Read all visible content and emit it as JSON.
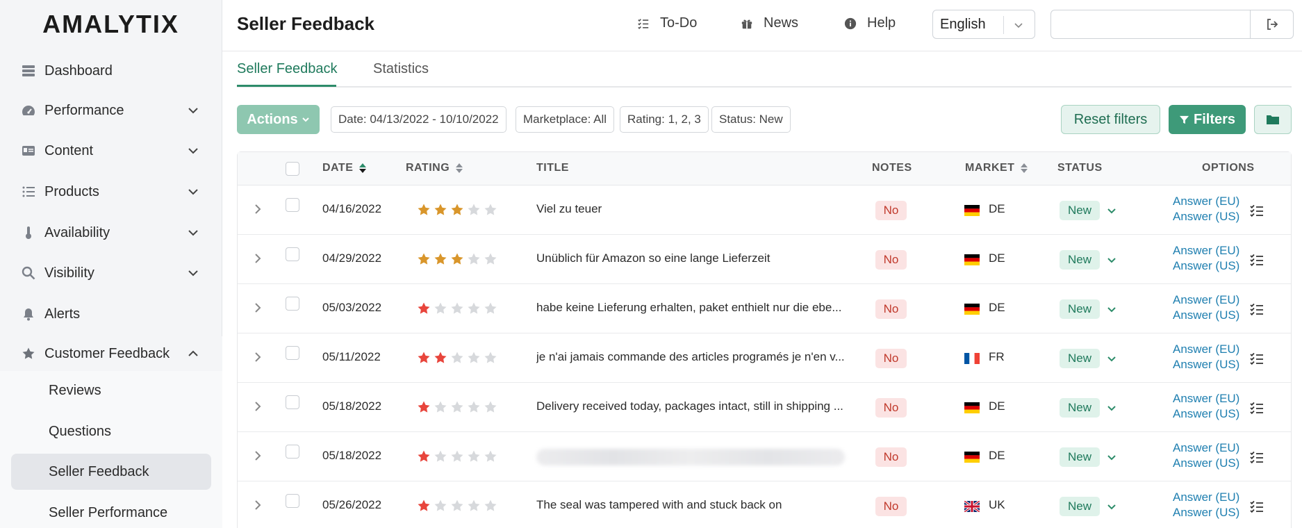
{
  "app": {
    "logo": "AMALYTIX"
  },
  "sidebar": {
    "items": [
      {
        "label": "Dashboard",
        "icon": "dashboard-icon",
        "has_chevron": false
      },
      {
        "label": "Performance",
        "icon": "gauge-icon",
        "has_chevron": true
      },
      {
        "label": "Content",
        "icon": "id-card-icon",
        "has_chevron": true
      },
      {
        "label": "Products",
        "icon": "list-icon",
        "has_chevron": true
      },
      {
        "label": "Availability",
        "icon": "thermometer-icon",
        "has_chevron": true
      },
      {
        "label": "Visibility",
        "icon": "search-icon",
        "has_chevron": true
      },
      {
        "label": "Alerts",
        "icon": "bell-icon",
        "has_chevron": false
      },
      {
        "label": "Customer Feedback",
        "icon": "star-icon",
        "has_chevron": true,
        "expanded": true
      }
    ],
    "subitems": [
      {
        "label": "Reviews",
        "active": false
      },
      {
        "label": "Questions",
        "active": false
      },
      {
        "label": "Seller Feedback",
        "active": true
      },
      {
        "label": "Seller Performance",
        "active": false
      }
    ]
  },
  "header": {
    "title": "Seller Feedback",
    "links": [
      {
        "label": "To-Do",
        "icon": "checklist-icon"
      },
      {
        "label": "News",
        "icon": "gift-icon"
      },
      {
        "label": "Help",
        "icon": "info-icon"
      }
    ],
    "language": "English",
    "search_value": ""
  },
  "tabs": [
    {
      "label": "Seller Feedback",
      "active": true
    },
    {
      "label": "Statistics",
      "active": false
    }
  ],
  "filters": {
    "actions_label": "Actions",
    "chips": [
      "Date: 04/13/2022 - 10/10/2022",
      "Marketplace: All",
      "Rating: 1, 2, 3",
      "Status: New"
    ],
    "reset_label": "Reset filters",
    "filters_label": "Filters"
  },
  "table": {
    "columns": [
      "DATE",
      "RATING",
      "TITLE",
      "NOTES",
      "MARKET",
      "STATUS",
      "OPTIONS"
    ],
    "rows": [
      {
        "date": "04/16/2022",
        "rating": 3,
        "title": "Viel zu teuer",
        "notes": "No",
        "market": "DE",
        "status": "New",
        "answer_eu": "Answer (EU)",
        "answer_us": "Answer (US)"
      },
      {
        "date": "04/29/2022",
        "rating": 3,
        "title": "Unüblich für Amazon so eine lange Lieferzeit",
        "notes": "No",
        "market": "DE",
        "status": "New",
        "answer_eu": "Answer (EU)",
        "answer_us": "Answer (US)"
      },
      {
        "date": "05/03/2022",
        "rating": 1,
        "title": "habe keine Lieferung erhalten, paket enthielt nur die ebe...",
        "notes": "No",
        "market": "DE",
        "status": "New",
        "answer_eu": "Answer (EU)",
        "answer_us": "Answer (US)"
      },
      {
        "date": "05/11/2022",
        "rating": 2,
        "title": "je n'ai jamais commande des articles programés je n'en v...",
        "notes": "No",
        "market": "FR",
        "status": "New",
        "answer_eu": "Answer (EU)",
        "answer_us": "Answer (US)"
      },
      {
        "date": "05/18/2022",
        "rating": 1,
        "title": "Delivery received today, packages intact, still in shipping ...",
        "notes": "No",
        "market": "DE",
        "status": "New",
        "answer_eu": "Answer (EU)",
        "answer_us": "Answer (US)"
      },
      {
        "date": "05/18/2022",
        "rating": 1,
        "title": "",
        "blurred": true,
        "notes": "No",
        "market": "DE",
        "status": "New",
        "answer_eu": "Answer (EU)",
        "answer_us": "Answer (US)"
      },
      {
        "date": "05/26/2022",
        "rating": 1,
        "title": "The seal was tampered with and stuck back on",
        "notes": "No",
        "market": "UK",
        "status": "New",
        "answer_eu": "Answer (EU)",
        "answer_us": "Answer (US)"
      }
    ]
  },
  "colors": {
    "accent": "#2d8c6a",
    "star_gold": "#d9962b",
    "star_red": "#e8453c",
    "star_empty": "#d7d9dc",
    "link": "#1f7fb0"
  }
}
